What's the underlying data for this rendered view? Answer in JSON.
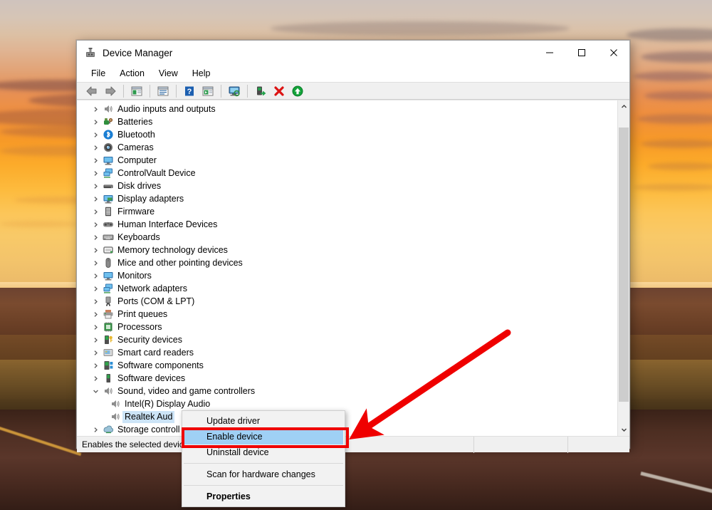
{
  "window": {
    "title": "Device Manager",
    "title_icon": "device-manager-icon",
    "controls": {
      "minimize": "—",
      "maximize": "☐",
      "close": "✕"
    }
  },
  "menubar": {
    "items": [
      {
        "label": "File",
        "name": "menu-file"
      },
      {
        "label": "Action",
        "name": "menu-action"
      },
      {
        "label": "View",
        "name": "menu-view"
      },
      {
        "label": "Help",
        "name": "menu-help"
      }
    ]
  },
  "toolbar": {
    "buttons": [
      {
        "name": "back-button",
        "icon": "arrow-left-icon"
      },
      {
        "name": "forward-button",
        "icon": "arrow-right-icon"
      },
      {
        "name": "show-hide-console-tree-button",
        "icon": "console-tree-icon"
      },
      {
        "name": "properties-button",
        "icon": "properties-window-icon"
      },
      {
        "name": "help-button",
        "icon": "question-mark-icon"
      },
      {
        "name": "show-hide-action-pane-button",
        "icon": "action-pane-icon"
      },
      {
        "name": "scan-for-hardware-changes-button",
        "icon": "monitor-scan-icon"
      },
      {
        "name": "update-driver-button",
        "icon": "update-driver-icon"
      },
      {
        "name": "uninstall-device-button",
        "icon": "red-x-icon"
      },
      {
        "name": "enable-device-button",
        "icon": "green-up-arrow-icon"
      }
    ]
  },
  "tree": {
    "items": [
      {
        "label": "Audio inputs and outputs",
        "icon": "speaker-icon",
        "expanded": false,
        "level": 0
      },
      {
        "label": "Batteries",
        "icon": "battery-icon",
        "expanded": false,
        "level": 0
      },
      {
        "label": "Bluetooth",
        "icon": "bluetooth-icon",
        "expanded": false,
        "level": 0
      },
      {
        "label": "Cameras",
        "icon": "camera-icon",
        "expanded": false,
        "level": 0
      },
      {
        "label": "Computer",
        "icon": "computer-icon",
        "expanded": false,
        "level": 0
      },
      {
        "label": "ControlVault Device",
        "icon": "network-device-icon",
        "expanded": false,
        "level": 0
      },
      {
        "label": "Disk drives",
        "icon": "disk-drive-icon",
        "expanded": false,
        "level": 0
      },
      {
        "label": "Display adapters",
        "icon": "display-adapter-icon",
        "expanded": false,
        "level": 0
      },
      {
        "label": "Firmware",
        "icon": "firmware-icon",
        "expanded": false,
        "level": 0
      },
      {
        "label": "Human Interface Devices",
        "icon": "hid-icon",
        "expanded": false,
        "level": 0
      },
      {
        "label": "Keyboards",
        "icon": "keyboard-icon",
        "expanded": false,
        "level": 0
      },
      {
        "label": "Memory technology devices",
        "icon": "memory-icon",
        "expanded": false,
        "level": 0
      },
      {
        "label": "Mice and other pointing devices",
        "icon": "mouse-icon",
        "expanded": false,
        "level": 0
      },
      {
        "label": "Monitors",
        "icon": "monitor-icon",
        "expanded": false,
        "level": 0
      },
      {
        "label": "Network adapters",
        "icon": "network-adapter-icon",
        "expanded": false,
        "level": 0
      },
      {
        "label": "Ports (COM & LPT)",
        "icon": "port-icon",
        "expanded": false,
        "level": 0
      },
      {
        "label": "Print queues",
        "icon": "printer-icon",
        "expanded": false,
        "level": 0
      },
      {
        "label": "Processors",
        "icon": "processor-icon",
        "expanded": false,
        "level": 0
      },
      {
        "label": "Security devices",
        "icon": "security-device-icon",
        "expanded": false,
        "level": 0
      },
      {
        "label": "Smart card readers",
        "icon": "smartcard-reader-icon",
        "expanded": false,
        "level": 0
      },
      {
        "label": "Software components",
        "icon": "software-component-icon",
        "expanded": false,
        "level": 0
      },
      {
        "label": "Software devices",
        "icon": "software-device-icon",
        "expanded": false,
        "level": 0
      },
      {
        "label": "Sound, video and game controllers",
        "icon": "speaker-icon",
        "expanded": true,
        "level": 0
      },
      {
        "label": "Intel(R) Display Audio",
        "icon": "speaker-icon",
        "expanded": null,
        "level": 1
      },
      {
        "label": "Realtek Aud",
        "icon": "speaker-icon",
        "expanded": null,
        "level": 1,
        "selected": true
      },
      {
        "label": "Storage controll",
        "icon": "storage-controller-icon",
        "expanded": false,
        "level": 0
      }
    ]
  },
  "scrollbar": {
    "up_arrow": "chevron-up-icon",
    "down_arrow": "chevron-down-icon",
    "thumb": "scrollbar-thumb"
  },
  "statusbar": {
    "message": "Enables the selected device.",
    "panel2": "",
    "panel3": ""
  },
  "context_menu": {
    "items": [
      {
        "label": "Update driver",
        "name": "context-menu-update-driver",
        "bold": false,
        "highlighted": false,
        "separator_after": false
      },
      {
        "label": "Enable device",
        "name": "context-menu-enable-device",
        "bold": false,
        "highlighted": true,
        "separator_after": false
      },
      {
        "label": "Uninstall device",
        "name": "context-menu-uninstall-device",
        "bold": false,
        "highlighted": false,
        "separator_after": true
      },
      {
        "label": "Scan for hardware changes",
        "name": "context-menu-scan-for-hardware-changes",
        "bold": false,
        "highlighted": false,
        "separator_after": true
      },
      {
        "label": "Properties",
        "name": "context-menu-properties",
        "bold": true,
        "highlighted": false,
        "separator_after": false
      }
    ]
  },
  "annotations": {
    "highlight_color": "#ef0000",
    "arrow_color": "#ef0000",
    "selection_color": "#9fd0f5",
    "target": "Enable device"
  }
}
